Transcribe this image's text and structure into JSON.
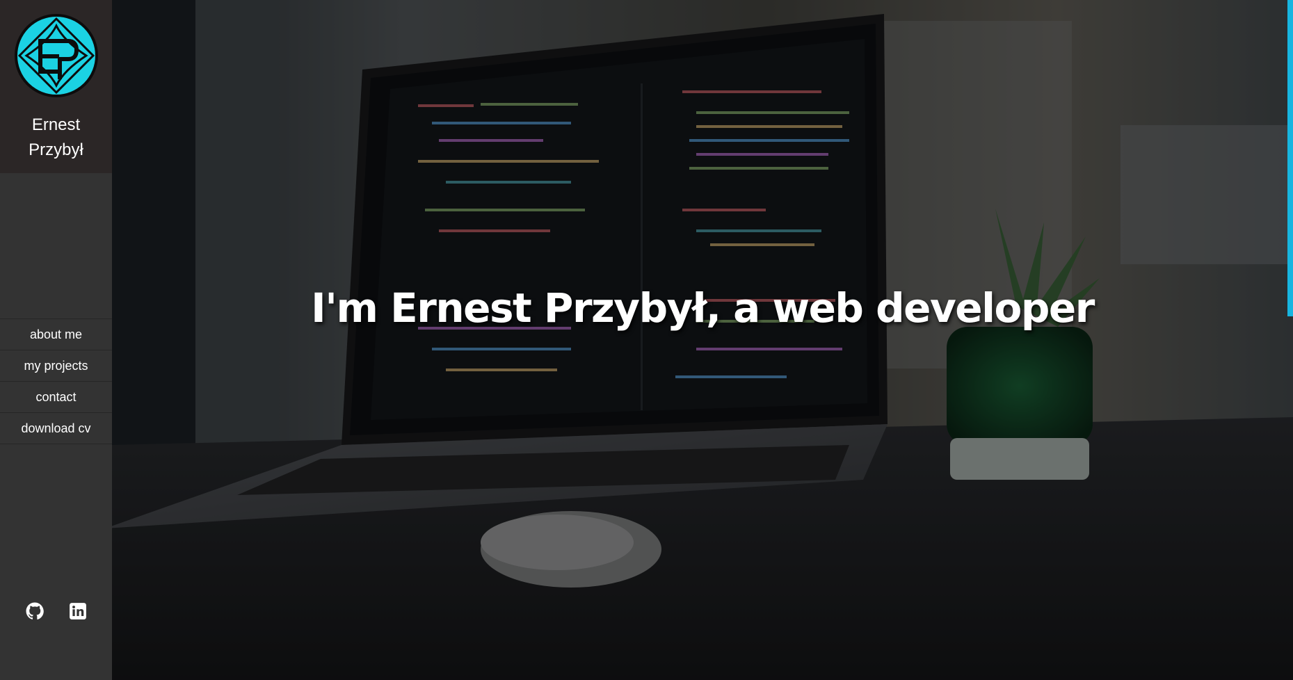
{
  "sidebar": {
    "brand": {
      "logo_icon": "ep-monogram-logo",
      "name_line1": "Ernest",
      "name_line2": "Przybył"
    },
    "nav": [
      {
        "label": "about me"
      },
      {
        "label": "my projects"
      },
      {
        "label": "contact"
      },
      {
        "label": "download cv"
      }
    ],
    "social": [
      {
        "icon": "github-icon"
      },
      {
        "icon": "linkedin-icon"
      }
    ]
  },
  "hero": {
    "title": "I'm Ernest Przybył, a web developer",
    "background": "laptop-with-code-editor-and-plant-photo"
  },
  "colors": {
    "accent": "#17b5e0",
    "logo_fill": "#1bd2e3",
    "sidebar_bg": "#333333",
    "brand_bg": "#2b2626",
    "text": "#ffffff"
  }
}
